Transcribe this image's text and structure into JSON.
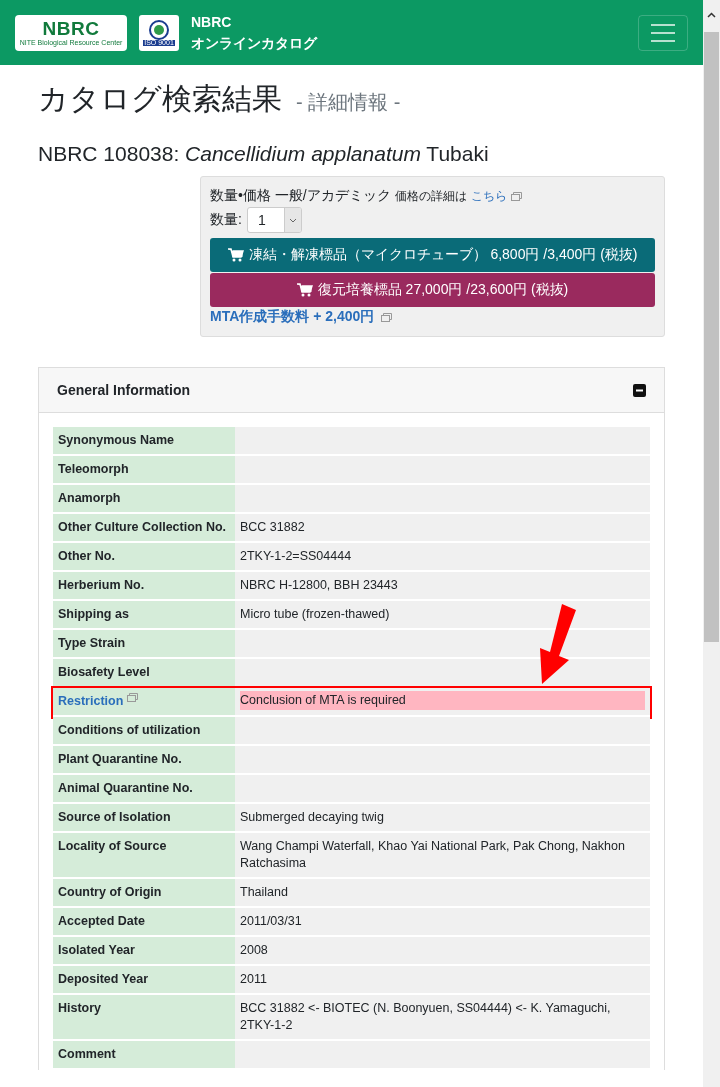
{
  "header": {
    "logo_text": "NBRC",
    "logo_subtext": "NITE Biological Resource Center",
    "iso_text": "ISO 9001",
    "site_name": "NBRC",
    "site_subtitle": "オンラインカタログ"
  },
  "page_title": "カタログ検索結果",
  "page_subtitle": "- 詳細情報 -",
  "strain": {
    "number": "NBRC 108038:",
    "species": "Cancellidium applanatum",
    "author": "Tubaki"
  },
  "price_box": {
    "heading": "数量•価格 一般/アカデミック",
    "note": "価格の詳細は",
    "link": "こちら",
    "quantity_label": "数量:",
    "quantity_value": "1",
    "buttons": [
      {
        "kind": "frozen",
        "label": "凍結・解凍標品（マイクロチューブ） 6,800円 /3,400円 (税抜)"
      },
      {
        "kind": "culture",
        "label": "復元培養標品 27,000円 /23,600円 (税抜)"
      }
    ],
    "mta_link": "MTA作成手数料 + 2,400円"
  },
  "general_info": {
    "title": "General Information",
    "expanded": true,
    "rows": [
      {
        "label": "Synonymous Name",
        "value": "",
        "kind": "plain",
        "highlighted": false
      },
      {
        "label": "Teleomorph",
        "value": "",
        "kind": "plain",
        "highlighted": false
      },
      {
        "label": "Anamorph",
        "value": "",
        "kind": "plain",
        "highlighted": false
      },
      {
        "label": "Other Culture Collection No.",
        "value": "BCC 31882",
        "kind": "plain",
        "highlighted": false
      },
      {
        "label": "Other No.",
        "value": "2TKY-1-2=SS04444",
        "kind": "plain",
        "highlighted": false
      },
      {
        "label": "Herberium No.",
        "value": "NBRC H-12800, BBH 23443",
        "kind": "plain",
        "highlighted": false
      },
      {
        "label": "Shipping as",
        "value": "Micro tube (frozen-thawed)",
        "kind": "plain",
        "highlighted": false
      },
      {
        "label": "Type Strain",
        "value": "",
        "kind": "plain",
        "highlighted": false
      },
      {
        "label": "Biosafety Level",
        "value": "",
        "kind": "plain",
        "highlighted": false
      },
      {
        "label": "Restriction",
        "value": "Conclusion of MTA is required",
        "kind": "link",
        "highlighted": true
      },
      {
        "label": "Conditions of utilization",
        "value": "",
        "kind": "plain",
        "highlighted": false
      },
      {
        "label": "Plant Quarantine No.",
        "value": "",
        "kind": "plain",
        "highlighted": false
      },
      {
        "label": "Animal Quarantine No.",
        "value": "",
        "kind": "plain",
        "highlighted": false
      },
      {
        "label": "Source of Isolation",
        "value": "Submerged decaying twig",
        "kind": "plain",
        "highlighted": false
      },
      {
        "label": "Locality of Source",
        "value": "Wang Champi Waterfall, Khao Yai National Park, Pak Chong, Nakhon Ratchasima",
        "kind": "plain",
        "highlighted": false
      },
      {
        "label": "Country of Origin",
        "value": "Thailand",
        "kind": "plain",
        "highlighted": false
      },
      {
        "label": "Accepted Date",
        "value": "2011/03/31",
        "kind": "plain",
        "highlighted": false
      },
      {
        "label": "Isolated Year",
        "value": "2008",
        "kind": "plain",
        "highlighted": false
      },
      {
        "label": "Deposited Year",
        "value": "2011",
        "kind": "plain",
        "highlighted": false
      },
      {
        "label": "History",
        "value": "BCC 31882 <- BIOTEC (N. Boonyuen, SS04444) <- K. Yamaguchi, 2TKY-1-2",
        "kind": "plain",
        "highlighted": false
      },
      {
        "label": "Comment",
        "value": "",
        "kind": "plain",
        "highlighted": false
      }
    ]
  }
}
